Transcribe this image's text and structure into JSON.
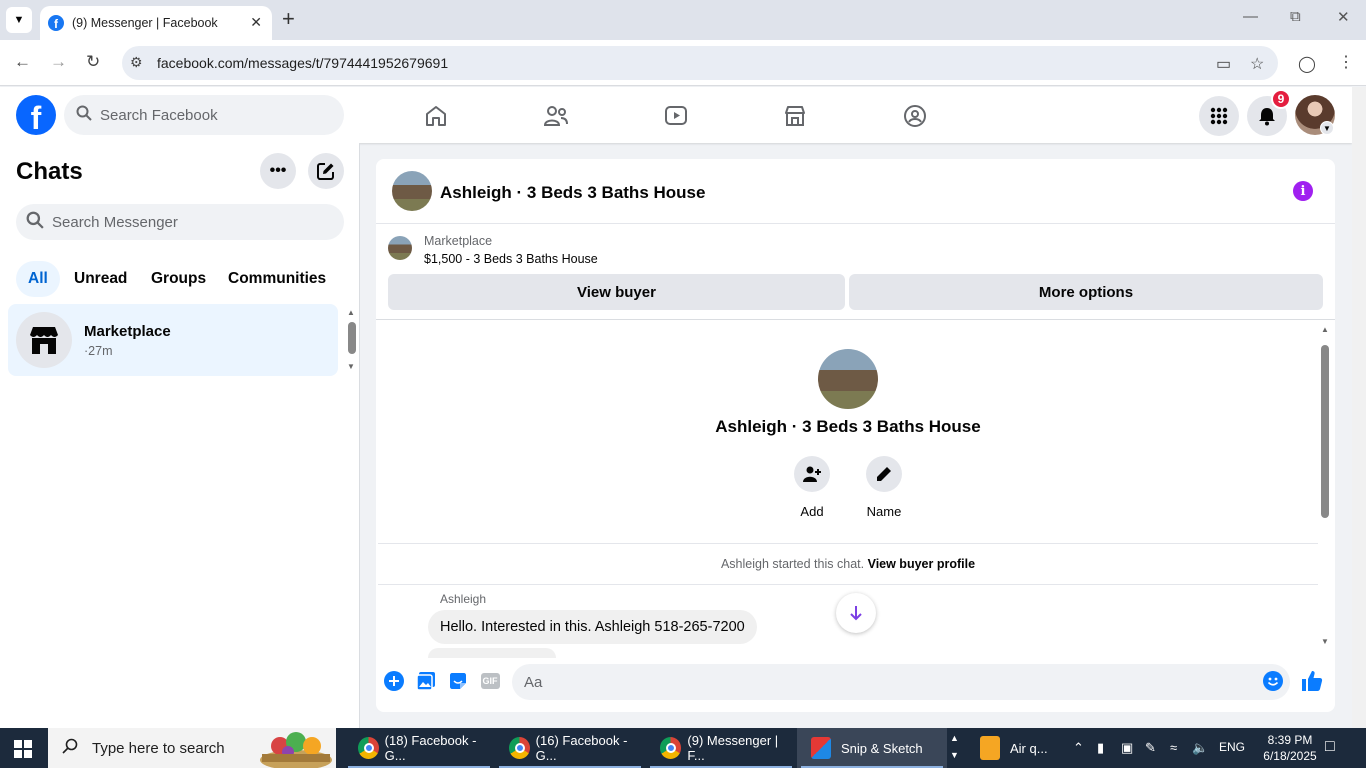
{
  "browser": {
    "tab_title": "(9) Messenger | Facebook",
    "url": "facebook.com/messages/t/7974441952679691"
  },
  "fb": {
    "search_placeholder": "Search Facebook",
    "notification_count": "9"
  },
  "sidebar": {
    "title": "Chats",
    "search_placeholder": "Search Messenger",
    "filters": [
      "All",
      "Unread",
      "Groups",
      "Communities"
    ],
    "chats": [
      {
        "name": "Marketplace",
        "time": "·27m"
      }
    ]
  },
  "conversation": {
    "title": "Ashleigh · 3 Beds 3 Baths House",
    "marketplace_label": "Marketplace",
    "listing": "$1,500 - 3 Beds 3 Baths House",
    "view_buyer_label": "View buyer",
    "more_options_label": "More options",
    "profile_name": "Ashleigh · 3 Beds 3 Baths House",
    "actions": [
      {
        "label": "Add"
      },
      {
        "label": "Name"
      }
    ],
    "started_text": "Ashleigh started this chat.",
    "view_profile_label": "View buyer profile",
    "messages": [
      {
        "sender": "Ashleigh",
        "text": "Hello. Interested in this. Ashleigh 518-265-7200"
      }
    ],
    "composer_placeholder": "Aa",
    "gif_label": "GIF"
  },
  "taskbar": {
    "search_placeholder": "Type here to search",
    "apps": [
      {
        "label": "(18) Facebook - G..."
      },
      {
        "label": "(16) Facebook - G..."
      },
      {
        "label": "(9) Messenger | F..."
      },
      {
        "label": "Snip & Sketch"
      },
      {
        "label": "Air q..."
      }
    ],
    "language": "ENG",
    "time": "8:39 PM",
    "date": "6/18/2025"
  }
}
